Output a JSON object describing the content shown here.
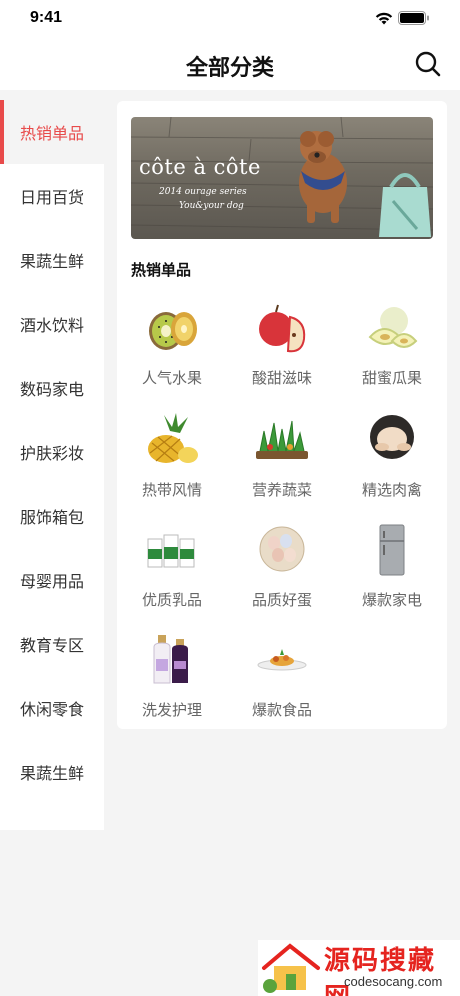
{
  "status_bar": {
    "time": "9:41"
  },
  "nav": {
    "title": "全部分类",
    "search_icon": "search-icon"
  },
  "sidebar": {
    "active_index": 0,
    "items": [
      {
        "label": "热销单品"
      },
      {
        "label": "日用百货"
      },
      {
        "label": "果蔬生鲜"
      },
      {
        "label": "酒水饮料"
      },
      {
        "label": "数码家电"
      },
      {
        "label": "护肤彩妆"
      },
      {
        "label": "服饰箱包"
      },
      {
        "label": "母婴用品"
      },
      {
        "label": "教育专区"
      },
      {
        "label": "休闲零食"
      },
      {
        "label": "果蔬生鲜"
      }
    ]
  },
  "banner": {
    "title": "côte à côte",
    "subtitle_1": "2014 ourage series",
    "subtitle_2": "You&your dog"
  },
  "section": {
    "title": "热销单品"
  },
  "grid": [
    {
      "label": "人气水果",
      "icon": "kiwi-icon"
    },
    {
      "label": "酸甜滋味",
      "icon": "apple-icon"
    },
    {
      "label": "甜蜜瓜果",
      "icon": "melon-icon"
    },
    {
      "label": "热带风情",
      "icon": "pineapple-icon"
    },
    {
      "label": "营养蔬菜",
      "icon": "vegetables-icon"
    },
    {
      "label": "精选肉禽",
      "icon": "chicken-icon"
    },
    {
      "label": "优质乳品",
      "icon": "milk-icon"
    },
    {
      "label": "品质好蛋",
      "icon": "eggs-icon"
    },
    {
      "label": "爆款家电",
      "icon": "fridge-icon"
    },
    {
      "label": "洗发护理",
      "icon": "shampoo-icon"
    },
    {
      "label": "爆款食品",
      "icon": "dish-icon"
    }
  ],
  "watermark": {
    "brand": "源码搜藏网",
    "url": "codesocang.com"
  },
  "colors": {
    "accent": "#e84a4a",
    "background": "#f4f4f4",
    "label_gray": "#666666"
  }
}
